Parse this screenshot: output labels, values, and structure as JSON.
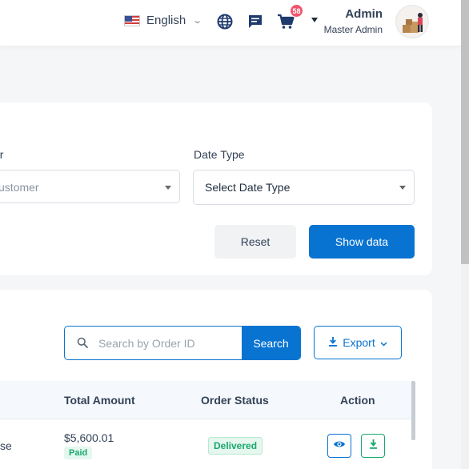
{
  "header": {
    "language_label": "English",
    "cart_count": "58",
    "user_name": "Admin",
    "user_role": "Master Admin",
    "icons": [
      "us-flag-icon",
      "globe-icon",
      "chat-icon",
      "cart-icon",
      "caret-down-icon",
      "avatar"
    ]
  },
  "filters": {
    "customer_label": "er",
    "customer_placeholder": "ustomer",
    "date_type_label": "Date Type",
    "date_type_value": "Select Date Type",
    "reset_label": "Reset",
    "show_label": "Show data"
  },
  "orders": {
    "search_placeholder": "Search by Order ID",
    "search_button": "Search",
    "export_label": "Export",
    "columns": [
      "Total Amount",
      "Order Status",
      "Action"
    ],
    "rows": [
      {
        "customer_fragment": "se",
        "total_amount": "$5,600.01",
        "payment_status": "Paid",
        "order_status": "Delivered"
      }
    ]
  },
  "colors": {
    "primary": "#0873d1",
    "success": "#17a86b",
    "badge": "#f0556c"
  }
}
